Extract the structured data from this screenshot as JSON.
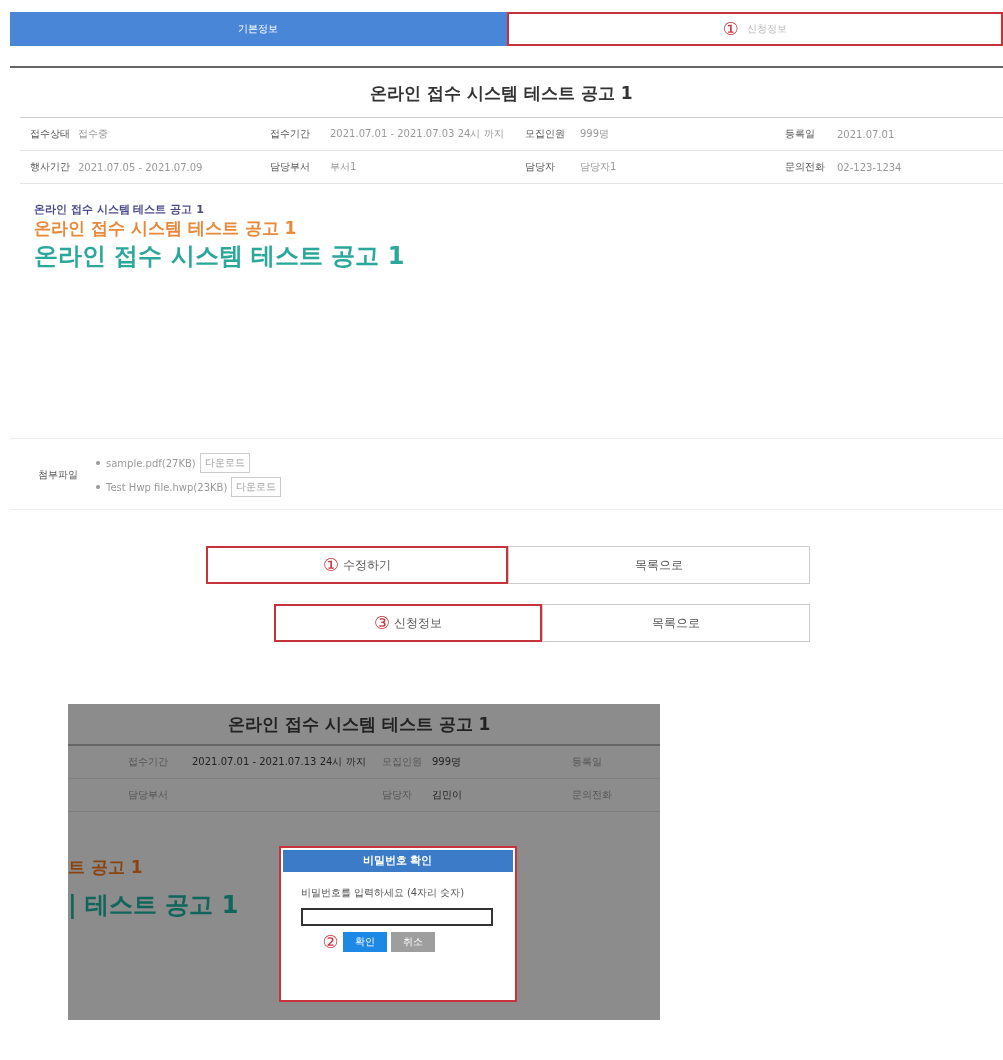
{
  "tabs": [
    {
      "label": "기본정보",
      "selected": true,
      "highlighted": false
    },
    {
      "label": "신청정보",
      "selected": false,
      "highlighted": true,
      "marker": "①"
    }
  ],
  "title": "온라인 접수 시스템 테스트 공고 1",
  "info_rows": [
    [
      {
        "label": "접수상태",
        "value": "접수중"
      },
      {
        "label": "접수기간",
        "value": "2021.07.01 - 2021.07.03 24시 까지"
      },
      {
        "label": "모집인원",
        "value": "999명"
      },
      {
        "label": "등록일",
        "value": "2021.07.01"
      }
    ],
    [
      {
        "label": "행사기간",
        "value": "2021.07.05 - 2021.07.09"
      },
      {
        "label": "담당부서",
        "value": "부서1"
      },
      {
        "label": "담당자",
        "value": "담당자1"
      },
      {
        "label": "문의전화",
        "value": "02-123-1234"
      }
    ]
  ],
  "body_lines": [
    {
      "text": "온라인 접수 시스템 테스트 공고 1",
      "color": "#4a4a8a",
      "kind": "small"
    },
    {
      "text": "온라인 접수 시스템 테스트 공고 1",
      "color": "#e8893a",
      "kind": "medium"
    },
    {
      "text": "온라인 접수 시스템 테스트 공고 1",
      "color": "#2aa89a",
      "kind": "large"
    }
  ],
  "attachments": {
    "label": "첨부파일",
    "files": [
      {
        "name": "sample.pdf(27KB)",
        "button": "다운로드"
      },
      {
        "name": "Test Hwp file.hwp(23KB)",
        "button": "다운로드"
      }
    ]
  },
  "button_rows": [
    [
      {
        "label": "수정하기",
        "highlighted": true,
        "marker": "①"
      },
      {
        "label": "목록으로",
        "highlighted": false
      }
    ],
    [
      {
        "label": "신청정보",
        "highlighted": true,
        "marker": "③"
      },
      {
        "label": "목록으로",
        "highlighted": false
      }
    ]
  ],
  "inset": {
    "title": "온라인 접수 시스템 테스트 공고 1",
    "rows": [
      [
        {
          "label": "접수기간",
          "value": "2021.07.01 - 2021.07.13 24시 까지"
        },
        {
          "label": "모집인원",
          "value": "999명"
        },
        {
          "label": "등록일"
        }
      ],
      [
        {
          "label": "담당부서"
        },
        {
          "label": "담당자",
          "value": "김민이"
        },
        {
          "label": "문의전화"
        }
      ]
    ],
    "cut_lines": [
      {
        "text": "트 공고 1",
        "color": "#8a4410",
        "kind": "medium"
      },
      {
        "text": "| 테스트 공고 1",
        "color": "#10665c",
        "kind": "large"
      }
    ],
    "dialog": {
      "title": "비밀번호 확인",
      "prompt": "비밀번호를 입력하세요 (4자리 숫자)",
      "highlighted": true,
      "marker": "②",
      "buttons": [
        {
          "label": "확인",
          "kind": "primary"
        },
        {
          "label": "취소",
          "kind": "secondary"
        }
      ]
    }
  }
}
